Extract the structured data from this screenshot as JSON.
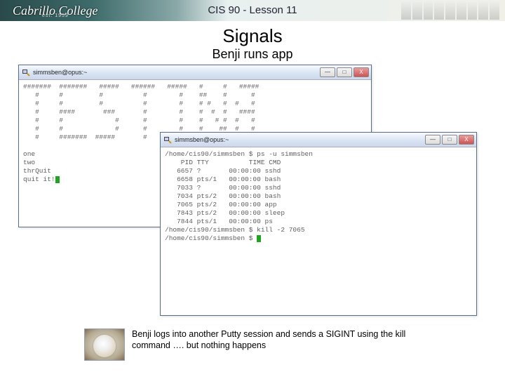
{
  "header": {
    "college_name": "Cabrillo College",
    "established": "est. 1959",
    "lesson": "CIS 90 - Lesson 11"
  },
  "slide": {
    "heading": "Signals",
    "subheading": "Benji runs app"
  },
  "window1": {
    "title": "simmsben@opus:~",
    "min_glyph": "—",
    "max_glyph": "□",
    "close_glyph": "X",
    "banner_l1": "#######  #######   #####   ######   #####   #     #   #####",
    "banner_l2": "   #     #         #          #        #    ##    #      #",
    "banner_l3": "   #     #         #          #        #    # #   #  #   #",
    "banner_l4": "   #     ####       ###       #        #    #  #  #   ####",
    "banner_l5": "   #     #             #      #        #    #   # #  #   #",
    "banner_l6": "   #     #             #      #        #    #    ##  #   #",
    "banner_l7": "   #     #######  #####       #     #####   #     #   #####",
    "msg1": "one",
    "msg2": "two",
    "msg3": "thrQuit",
    "msg4": "quit it!"
  },
  "window2": {
    "title": "simmsben@opus:~",
    "min_glyph": "—",
    "max_glyph": "□",
    "close_glyph": "X",
    "prompt1": "/home/cis90/simmsben $ ps -u simmsben",
    "header": "    PID TTY          TIME CMD",
    "ps": [
      {
        "pid": "6657",
        "tty": "?",
        "time": "00:00:00",
        "cmd": "sshd"
      },
      {
        "pid": "6658",
        "tty": "pts/1",
        "time": "00:00:00",
        "cmd": "bash"
      },
      {
        "pid": "7033",
        "tty": "?",
        "time": "00:00:00",
        "cmd": "sshd"
      },
      {
        "pid": "7034",
        "tty": "pts/2",
        "time": "00:00:00",
        "cmd": "bash"
      },
      {
        "pid": "7065",
        "tty": "pts/2",
        "time": "00:00:00",
        "cmd": "app"
      },
      {
        "pid": "7843",
        "tty": "pts/2",
        "time": "00:00:00",
        "cmd": "sleep"
      },
      {
        "pid": "7844",
        "tty": "pts/1",
        "time": "00:00:00",
        "cmd": "ps"
      }
    ],
    "prompt2": "/home/cis90/simmsben $ kill -2 7065",
    "prompt3": "/home/cis90/simmsben $ "
  },
  "footer": {
    "caption": "Benji logs into another Putty session and sends a SIGINT using the kill command …. but nothing happens"
  }
}
